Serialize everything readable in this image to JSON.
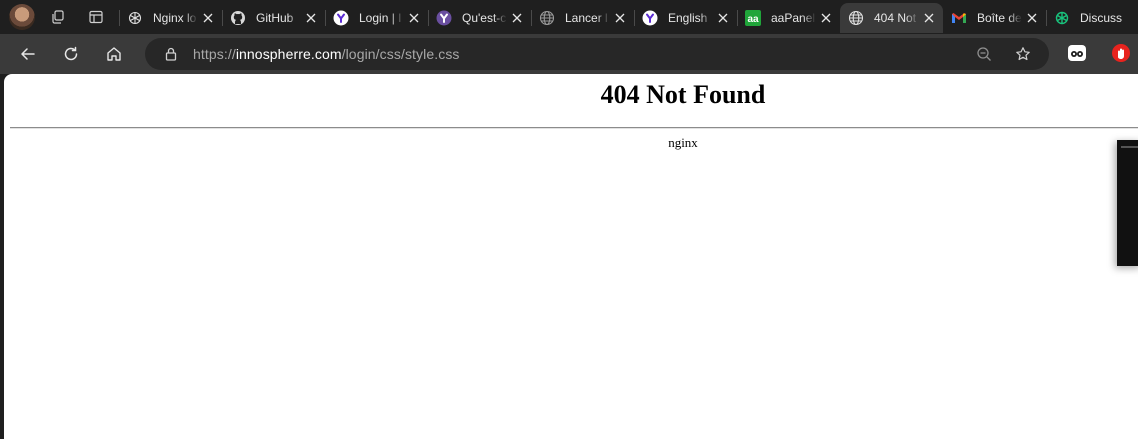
{
  "browser": {
    "tabs": [
      {
        "title": "Nginx lo",
        "favicon": "openai-icon",
        "active": false
      },
      {
        "title": "GitHub",
        "favicon": "github-icon",
        "active": false
      },
      {
        "title": "Login | I",
        "favicon": "purple-badge-icon",
        "active": false
      },
      {
        "title": "Qu'est-c",
        "favicon": "purple-badge-icon",
        "active": false
      },
      {
        "title": "Lancer l",
        "favicon": "globe-icon",
        "active": false
      },
      {
        "title": "English",
        "favicon": "purple-badge-icon",
        "active": false
      },
      {
        "title": "aaPanel",
        "favicon": "aapanel-icon",
        "active": false
      },
      {
        "title": "404 Not",
        "favicon": "globe-icon",
        "active": true
      },
      {
        "title": "Boîte de",
        "favicon": "gmail-icon",
        "active": false
      },
      {
        "title": "Discuss",
        "favicon": "chatgpt-icon",
        "active": false
      }
    ],
    "address": {
      "scheme": "https://",
      "host": "innospherre.com",
      "path": "/login/css/style.css"
    }
  },
  "page": {
    "heading": "404 Not Found",
    "footer": "nginx"
  },
  "colors": {
    "tabstrip_bg": "#1f1f1f",
    "toolbar_bg": "#3a3a3a",
    "addressbar_bg": "#272727",
    "page_bg": "#ffffff",
    "aapanel_green": "#20a53a",
    "badge_purple": "#5b2bd3"
  }
}
